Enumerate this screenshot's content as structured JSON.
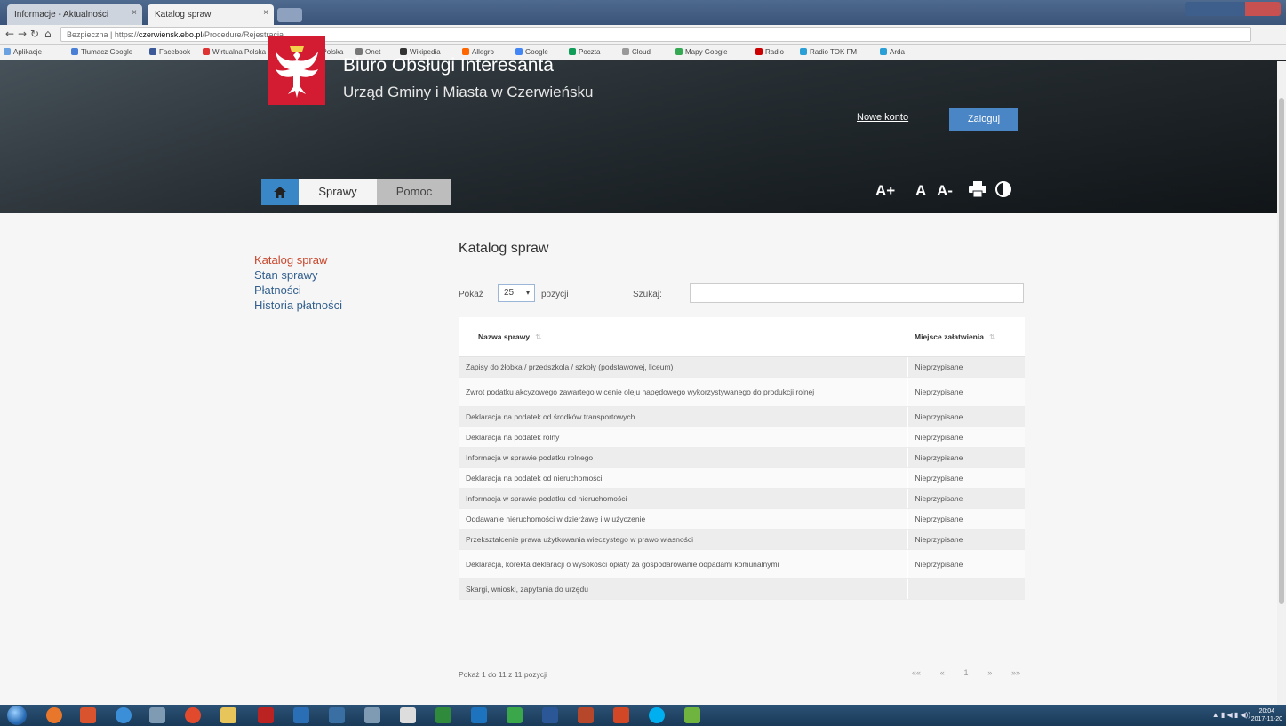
{
  "browser": {
    "tabs": [
      {
        "label": "Informacje - Aktualności"
      },
      {
        "label": "Katalog spraw"
      }
    ],
    "address": {
      "prefix": "Bezpieczna | https://",
      "host": "czerwiensk.ebo.pl",
      "path": "/Procedure/Rejestracja"
    },
    "bookmarks": [
      "Aplikacje",
      "Tłumacz Google",
      "Facebook",
      "Wirtualna Polska",
      "Gazeta.pl - Polska",
      "Onet",
      "Wikipedia",
      "Allegro",
      "Google",
      "Poczta",
      "Cloud",
      "Mapy Google",
      "Radio",
      "Radio TOK FM",
      "Arda"
    ]
  },
  "header": {
    "title": "Biuro Obsługi Interesanta",
    "subtitle": "Urząd Gminy i Miasta w Czerwieńsku",
    "new_account": "Nowe konto",
    "login": "Zaloguj",
    "nav": {
      "sprawy": "Sprawy",
      "pomoc": "Pomoc"
    },
    "a11y": {
      "font_up": "A+",
      "font_normal": "A",
      "font_down": "A-"
    }
  },
  "sidebar": {
    "items": [
      {
        "label": "Katalog spraw"
      },
      {
        "label": "Stan sprawy"
      },
      {
        "label": "Płatności"
      },
      {
        "label": "Historia płatności"
      }
    ]
  },
  "main": {
    "title": "Katalog spraw",
    "length_label": "Pokaż",
    "length_value": "25",
    "length_after": "pozycji",
    "search_label": "Szukaj:",
    "search_value": "",
    "columns": [
      "Nazwa sprawy",
      "Miejsce załatwienia"
    ],
    "rows": [
      {
        "name": "Zapisy do żłobka / przedszkola / szkoły (podstawowej, liceum)",
        "place": "Nieprzypisane"
      },
      {
        "name": "Zwrot podatku akcyzowego zawartego w cenie oleju napędowego wykorzystywanego do produkcji rolnej",
        "place": "Nieprzypisane"
      },
      {
        "name": "Deklaracja na podatek od środków transportowych",
        "place": "Nieprzypisane"
      },
      {
        "name": "Deklaracja na podatek rolny",
        "place": "Nieprzypisane"
      },
      {
        "name": "Informacja w sprawie podatku rolnego",
        "place": "Nieprzypisane"
      },
      {
        "name": "Deklaracja na podatek od nieruchomości",
        "place": "Nieprzypisane"
      },
      {
        "name": "Informacja w sprawie podatku od nieruchomości",
        "place": "Nieprzypisane"
      },
      {
        "name": "Oddawanie nieruchomości w dzierżawę i w użyczenie",
        "place": "Nieprzypisane"
      },
      {
        "name": "Przekształcenie prawa użytkowania wieczystego w prawo własności",
        "place": "Nieprzypisane"
      },
      {
        "name": "Deklaracja, korekta deklaracji o wysokości opłaty za gospodarowanie odpadami komunalnymi",
        "place": "Nieprzypisane"
      },
      {
        "name": "Skargi, wnioski, zapytania do urzędu",
        "place": ""
      }
    ],
    "info": "Pokaż 1 do 11 z 11 pozycji",
    "pager": [
      "««",
      "«",
      "1",
      "»",
      "»»"
    ]
  },
  "taskbar": {
    "clock_time": "20:04",
    "clock_date": "2017-11-20"
  },
  "colors": {
    "accent": "#3a87c7",
    "active_link": "#c9472c",
    "link": "#33608f",
    "emblem": "#d31c32"
  }
}
